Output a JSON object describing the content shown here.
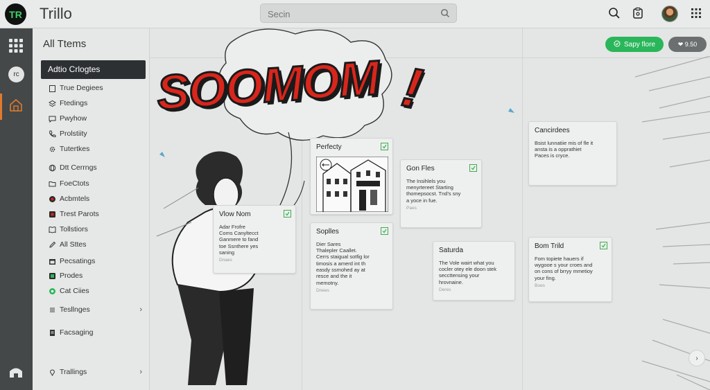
{
  "app": {
    "logo_text": "TR",
    "title": "Trillo"
  },
  "search": {
    "placeholder": "Secin"
  },
  "topbar_icons": [
    "search-icon",
    "clipboard-icon",
    "avatar",
    "grid-icon"
  ],
  "rail": {
    "badge_text": "rc",
    "icons": [
      "apps-grid-icon",
      "home-icon",
      "bottom-home-icon"
    ]
  },
  "sidebar": {
    "title": "All Ttems",
    "active_item": "Adtio Crlogtes",
    "items": [
      {
        "label": "True Degiees",
        "icon": "clipboard-icon"
      },
      {
        "label": "Ftedings",
        "icon": "layers-icon"
      },
      {
        "label": "Pwyhow",
        "icon": "chat-icon"
      },
      {
        "label": "Prolstiity",
        "icon": "phone-icon"
      },
      {
        "label": "Tutertkes",
        "icon": "gear-icon"
      },
      {
        "label": "Dtt Cerrngs",
        "icon": "globe-icon"
      },
      {
        "label": "FoeCtots",
        "icon": "folder-icon"
      },
      {
        "label": "Acbmtels",
        "icon": "red-badge-icon"
      },
      {
        "label": "Trest Parots",
        "icon": "red-square-icon"
      },
      {
        "label": "Tollstiors",
        "icon": "book-icon"
      },
      {
        "label": "All Sttes",
        "icon": "pen-icon"
      },
      {
        "label": "Pecsatings",
        "icon": "calendar-icon"
      },
      {
        "label": "Prodes",
        "icon": "green-square-icon"
      },
      {
        "label": "Cat Ciies",
        "icon": "green-dot-icon"
      },
      {
        "label": "Tesllnges",
        "icon": "list-icon",
        "chevron": "›"
      },
      {
        "label": "Facsaging",
        "icon": "document-icon"
      },
      {
        "label": "Trallings",
        "icon": "pin-icon",
        "chevron": "›"
      }
    ]
  },
  "header_buttons": {
    "primary": "Sapy flore",
    "secondary": "❤ 9.50"
  },
  "comic": {
    "shout": "SOOMOM",
    "bang": "!"
  },
  "cards": [
    {
      "title": "Perfecty",
      "body": "",
      "meta": ""
    },
    {
      "title": "Vlow Nom",
      "body": "Adar Frofre\nComs Canyltecct\nGanmere to fand\ntoe Ssnthere yes\nsaning",
      "meta": "Dnaes"
    },
    {
      "title": "Gon Fles",
      "body": "The Insihlels you\nmenyrtereet Starting\nthomepsocst. Tnd's sny\na yoce in fue.",
      "meta": "Paes"
    },
    {
      "title": "Soplles",
      "body": "Dier Sares\nThalepler Caallet.\nCerrs staigual sotfig lor\ntimosis a amerd int th\neasdy ssmohed ay at\nresce and the it\nmemotny.",
      "meta": "Dnees"
    },
    {
      "title": "Saturda",
      "body": "The Vole wairt what you\ncocler otey ele doon stek\nseccttensing your\nhrovnaine.",
      "meta": "Deres"
    },
    {
      "title": "Cancirdees",
      "body": "Bsist lunnatiie mis of fle it\nansta is a opprathiet\nPaces is cryce.",
      "meta": ""
    },
    {
      "title": "Bom Trild",
      "body": "Fom topiete hauers if\nwygooe s your croes and\non cons of brryy mmetioy\nyour fing.",
      "meta": "Boes"
    }
  ],
  "colors": {
    "accent_green": "#2ab65a",
    "shout_red": "#d9261c",
    "rail": "#444849",
    "active_orange": "#e07a2c"
  }
}
